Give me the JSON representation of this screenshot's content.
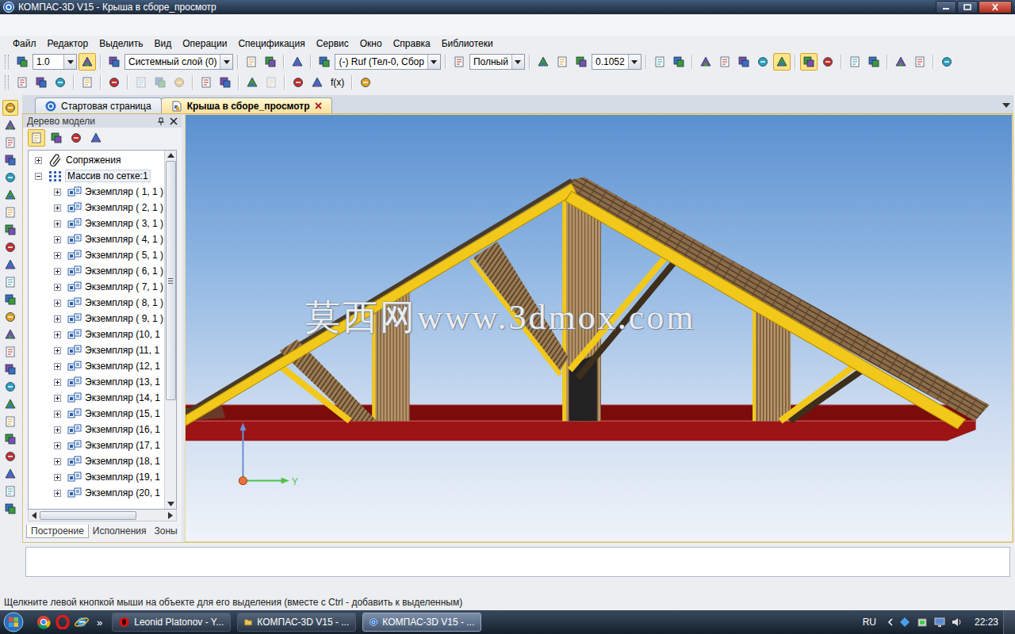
{
  "window": {
    "title": "КОМПАС-3D V15 - Крыша в сборе_просмотр"
  },
  "menu": [
    "Файл",
    "Редактор",
    "Выделить",
    "Вид",
    "Операции",
    "Спецификация",
    "Сервис",
    "Окно",
    "Справка",
    "Библиотеки"
  ],
  "toolbar1": [
    {
      "kind": "button",
      "pressed": false
    },
    {
      "kind": "combo",
      "value": "1.0"
    },
    {
      "kind": "button",
      "pressed": true
    },
    {
      "kind": "sep"
    },
    {
      "kind": "button",
      "pressed": false
    },
    {
      "kind": "combo",
      "value": "Системный слой (0)"
    },
    {
      "kind": "sep"
    },
    {
      "kind": "button",
      "pressed": false
    },
    {
      "kind": "button",
      "pressed": false
    },
    {
      "kind": "sep"
    },
    {
      "kind": "button",
      "pressed": false
    },
    {
      "kind": "sep"
    },
    {
      "kind": "button",
      "pressed": false
    },
    {
      "kind": "combo",
      "value": "(-) Ruf (Тел-0, Сбор"
    },
    {
      "kind": "sep"
    },
    {
      "kind": "button",
      "pressed": false
    },
    {
      "kind": "combo",
      "value": "Полный"
    },
    {
      "kind": "sep"
    },
    {
      "kind": "button",
      "pressed": false
    },
    {
      "kind": "button",
      "pressed": false
    },
    {
      "kind": "button",
      "pressed": false
    },
    {
      "kind": "combo",
      "value": "0.1052"
    },
    {
      "kind": "sep"
    },
    {
      "kind": "button",
      "pressed": false
    },
    {
      "kind": "button",
      "pressed": false
    },
    {
      "kind": "sep"
    },
    {
      "kind": "button",
      "pressed": false
    },
    {
      "kind": "button",
      "pressed": false
    },
    {
      "kind": "button",
      "pressed": false
    },
    {
      "kind": "button",
      "pressed": false
    },
    {
      "kind": "button",
      "pressed": true
    },
    {
      "kind": "sep"
    },
    {
      "kind": "button",
      "pressed": true
    },
    {
      "kind": "button",
      "pressed": false
    },
    {
      "kind": "sep"
    },
    {
      "kind": "button",
      "pressed": false
    },
    {
      "kind": "button",
      "pressed": false
    },
    {
      "kind": "sep"
    },
    {
      "kind": "button",
      "pressed": false
    },
    {
      "kind": "button",
      "pressed": false
    },
    {
      "kind": "sep"
    },
    {
      "kind": "button",
      "pressed": false
    }
  ],
  "toolbar2": [
    {
      "kind": "button",
      "disabled": false
    },
    {
      "kind": "button",
      "disabled": false
    },
    {
      "kind": "button",
      "disabled": false
    },
    {
      "kind": "sep"
    },
    {
      "kind": "button",
      "disabled": false
    },
    {
      "kind": "sep"
    },
    {
      "kind": "button",
      "disabled": false
    },
    {
      "kind": "sep"
    },
    {
      "kind": "button",
      "disabled": true
    },
    {
      "kind": "button",
      "disabled": true
    },
    {
      "kind": "button",
      "disabled": true
    },
    {
      "kind": "sep"
    },
    {
      "kind": "button",
      "disabled": false
    },
    {
      "kind": "button",
      "disabled": false
    },
    {
      "kind": "sep"
    },
    {
      "kind": "button",
      "disabled": false
    },
    {
      "kind": "button",
      "disabled": true
    },
    {
      "kind": "sep"
    },
    {
      "kind": "button",
      "disabled": false
    },
    {
      "kind": "button",
      "disabled": false
    },
    {
      "kind": "text",
      "label": "f(x)",
      "disabled": false
    },
    {
      "kind": "sep"
    },
    {
      "kind": "button",
      "disabled": false
    }
  ],
  "side_toolbar": [
    {
      "pressed": true
    },
    {
      "pressed": false
    },
    {
      "pressed": false
    },
    {
      "pressed": false
    },
    {
      "pressed": false
    },
    {
      "pressed": false
    },
    {
      "pressed": false
    },
    {
      "pressed": false
    },
    {
      "pressed": false
    },
    {
      "pressed": false
    },
    {
      "pressed": false
    },
    {
      "pressed": false
    },
    {
      "pressed": false
    },
    {
      "pressed": false
    },
    {
      "pressed": false
    },
    {
      "pressed": false
    },
    {
      "pressed": false
    },
    {
      "pressed": false
    },
    {
      "pressed": false
    },
    {
      "pressed": false
    },
    {
      "pressed": false
    },
    {
      "pressed": false
    },
    {
      "pressed": false
    },
    {
      "pressed": false
    }
  ],
  "doc_tabs": [
    {
      "label": "Стартовая страница",
      "selected": false
    },
    {
      "label": "Крыша в сборе_просмотр",
      "selected": true
    }
  ],
  "tree_panel": {
    "title": "Дерево модели",
    "toolbar": [
      {
        "pressed": true
      },
      {
        "pressed": false
      },
      {
        "pressed": false
      },
      {
        "pressed": false
      }
    ],
    "items": [
      {
        "label": "Сопряжения",
        "kind": "mates",
        "expanded": false,
        "selected": false
      },
      {
        "label": "Массив по сетке:1",
        "kind": "array",
        "expanded": true,
        "selected": true
      },
      {
        "label": "Экземпляр ( 1, 1 )",
        "kind": "instance",
        "expanded": false,
        "selected": false
      },
      {
        "label": "Экземпляр ( 2, 1 )",
        "kind": "instance",
        "expanded": false,
        "selected": false
      },
      {
        "label": "Экземпляр ( 3, 1 )",
        "kind": "instance",
        "expanded": false,
        "selected": false
      },
      {
        "label": "Экземпляр ( 4, 1 )",
        "kind": "instance",
        "expanded": false,
        "selected": false
      },
      {
        "label": "Экземпляр ( 5, 1 )",
        "kind": "instance",
        "expanded": false,
        "selected": false
      },
      {
        "label": "Экземпляр ( 6, 1 )",
        "kind": "instance",
        "expanded": false,
        "selected": false
      },
      {
        "label": "Экземпляр ( 7, 1 )",
        "kind": "instance",
        "expanded": false,
        "selected": false
      },
      {
        "label": "Экземпляр ( 8, 1 )",
        "kind": "instance",
        "expanded": false,
        "selected": false
      },
      {
        "label": "Экземпляр ( 9, 1 )",
        "kind": "instance",
        "expanded": false,
        "selected": false
      },
      {
        "label": "Экземпляр (10, 1",
        "kind": "instance",
        "expanded": false,
        "selected": false
      },
      {
        "label": "Экземпляр (11, 1",
        "kind": "instance",
        "expanded": false,
        "selected": false
      },
      {
        "label": "Экземпляр (12, 1",
        "kind": "instance",
        "expanded": false,
        "selected": false
      },
      {
        "label": "Экземпляр (13, 1",
        "kind": "instance",
        "expanded": false,
        "selected": false
      },
      {
        "label": "Экземпляр (14, 1",
        "kind": "instance",
        "expanded": false,
        "selected": false
      },
      {
        "label": "Экземпляр (15, 1",
        "kind": "instance",
        "expanded": false,
        "selected": false
      },
      {
        "label": "Экземпляр (16, 1",
        "kind": "instance",
        "expanded": false,
        "selected": false
      },
      {
        "label": "Экземпляр (17, 1",
        "kind": "instance",
        "expanded": false,
        "selected": false
      },
      {
        "label": "Экземпляр (18, 1",
        "kind": "instance",
        "expanded": false,
        "selected": false
      },
      {
        "label": "Экземпляр (19, 1",
        "kind": "instance",
        "expanded": false,
        "selected": false
      },
      {
        "label": "Экземпляр (20, 1",
        "kind": "instance",
        "expanded": false,
        "selected": false
      }
    ],
    "tabs": [
      {
        "label": "Построение",
        "selected": true
      },
      {
        "label": "Исполнения",
        "selected": false
      },
      {
        "label": "Зоны",
        "selected": false
      }
    ]
  },
  "viewport": {
    "watermark": "莫西网www.3dmox.com",
    "axis_label": "Y"
  },
  "status_bar": "Щелкните левой кнопкой мыши на объекте для его выделения (вместе с Ctrl - добавить к выделенным)",
  "taskbar": {
    "more": "»",
    "buttons": [
      {
        "label": "Leonid Platonov - Y...",
        "kind": "browser",
        "selected": false
      },
      {
        "label": "КОМПАС-3D V15 - ...",
        "kind": "folder",
        "selected": false
      },
      {
        "label": "КОМПАС-3D V15 - ...",
        "kind": "app",
        "selected": true
      }
    ],
    "lang": "RU",
    "clock": "22:23"
  }
}
